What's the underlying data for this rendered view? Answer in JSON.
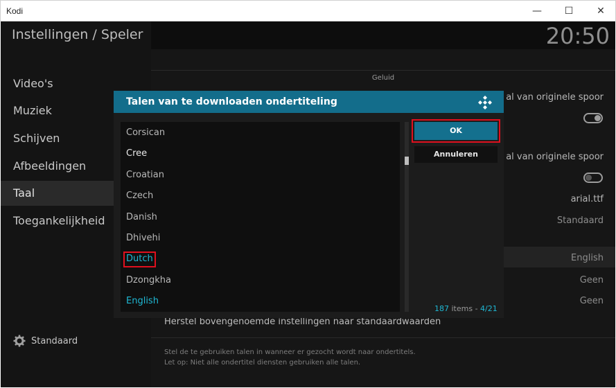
{
  "window": {
    "title": "Kodi",
    "minimize": "—",
    "maximize": "☐",
    "close": "✕"
  },
  "header": {
    "title": "Instellingen / Speler",
    "clock": "20:50"
  },
  "sidebar": {
    "items": [
      {
        "label": "Video's",
        "active": false
      },
      {
        "label": "Muziek",
        "active": false
      },
      {
        "label": "Schijven",
        "active": false
      },
      {
        "label": "Afbeeldingen",
        "active": false
      },
      {
        "label": "Taal",
        "active": true
      },
      {
        "label": "Toegankelijkheid",
        "active": false
      }
    ],
    "level_label": "Standaard"
  },
  "settings": {
    "section": "Geluid",
    "row1": "al van originele spoor",
    "row2": "al van originele spoor",
    "font": "arial.ttf",
    "size": "Standaard",
    "lang": "English",
    "none1": "Geen",
    "none2": "Geen",
    "reset": "Herstel bovengenoemde instellingen naar standaardwaarden",
    "hint1": "Stel de te gebruiken talen in wanneer er gezocht wordt naar ondertitels.",
    "hint2": "Let op: Niet alle ondertitel diensten gebruiken alle talen."
  },
  "dialog": {
    "title": "Talen van te downloaden ondertiteling",
    "items": [
      {
        "label": "Corsican",
        "state": "normal"
      },
      {
        "label": "Cree",
        "state": "white"
      },
      {
        "label": "Croatian",
        "state": "normal"
      },
      {
        "label": "Czech",
        "state": "normal"
      },
      {
        "label": "Danish",
        "state": "normal"
      },
      {
        "label": "Dhivehi",
        "state": "normal"
      },
      {
        "label": "Dutch",
        "state": "selected"
      },
      {
        "label": "Dzongkha",
        "state": "normal"
      },
      {
        "label": "English",
        "state": "selected"
      }
    ],
    "ok": "OK",
    "cancel": "Annuleren",
    "count": "187",
    "count_suffix": " items - ",
    "page": "4/21"
  },
  "colors": {
    "accent": "#136d8b",
    "selected_text": "#1fb8d4",
    "highlight_box": "#e0101e"
  }
}
